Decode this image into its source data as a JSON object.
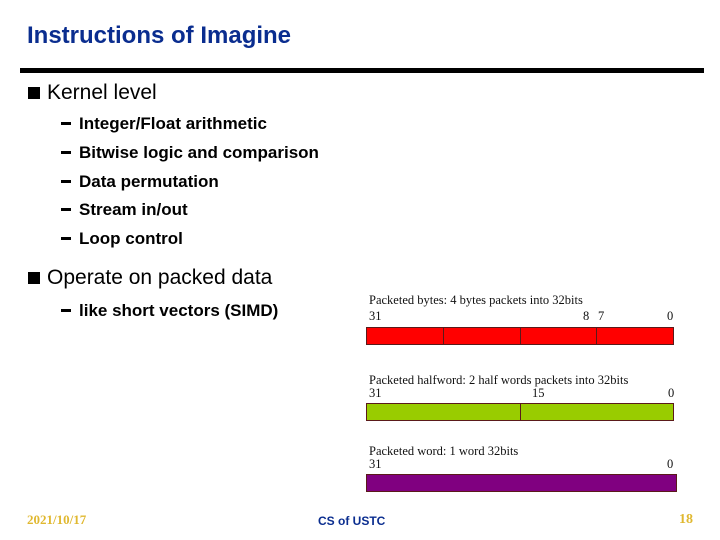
{
  "slide": {
    "title": "Instructions of Imagine",
    "bullets": [
      {
        "text": "Kernel level",
        "subitems": [
          "Integer/Float arithmetic",
          "Bitwise logic and comparison",
          "Data permutation",
          "Stream in/out",
          "Loop control"
        ]
      },
      {
        "text": "Operate on packed data",
        "subitems": [
          "like short vectors (SIMD)"
        ]
      }
    ],
    "diagrams": [
      {
        "caption": "Packeted bytes: 4 bytes packets into 32bits",
        "bit_labels": [
          "31",
          "8",
          "7",
          "0"
        ],
        "segments": 4,
        "color": "#ff0000"
      },
      {
        "caption": "Packeted halfword: 2 half words packets into 32bits",
        "bit_labels": [
          "31",
          "15",
          "0"
        ],
        "segments": 2,
        "color": "#99cc00"
      },
      {
        "caption": "Packeted word: 1 word 32bits",
        "bit_labels": [
          "31",
          "0"
        ],
        "segments": 1,
        "color": "#800080"
      }
    ],
    "footer": {
      "date": "2021/10/17",
      "center": "CS of USTC",
      "page": "18"
    }
  }
}
